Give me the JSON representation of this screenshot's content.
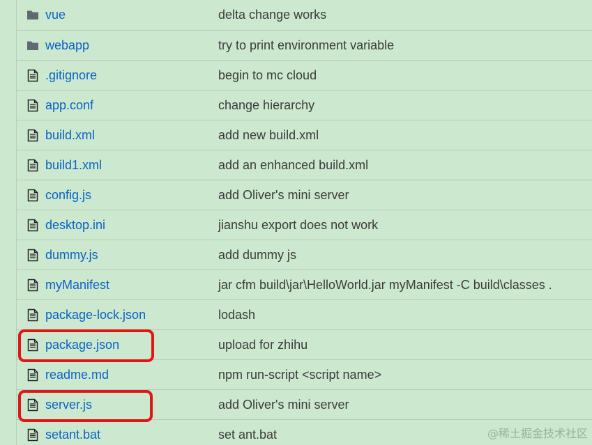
{
  "files": [
    {
      "icon": "folder-icon",
      "name": "vue",
      "message": "delta change works"
    },
    {
      "icon": "folder-icon",
      "name": "webapp",
      "message": "try to print environment variable"
    },
    {
      "icon": "file-icon",
      "name": ".gitignore",
      "message": "begin to mc cloud"
    },
    {
      "icon": "file-icon",
      "name": "app.conf",
      "message": "change hierarchy"
    },
    {
      "icon": "file-icon",
      "name": "build.xml",
      "message": "add new build.xml"
    },
    {
      "icon": "file-icon",
      "name": "build1.xml",
      "message": "add an enhanced build.xml"
    },
    {
      "icon": "file-icon",
      "name": "config.js",
      "message": "add Oliver's mini server"
    },
    {
      "icon": "file-icon",
      "name": "desktop.ini",
      "message": "jianshu export does not work"
    },
    {
      "icon": "file-icon",
      "name": "dummy.js",
      "message": "add dummy js"
    },
    {
      "icon": "file-icon",
      "name": "myManifest",
      "message": "jar cfm build\\jar\\HelloWorld.jar myManifest -C build\\classes ."
    },
    {
      "icon": "file-icon",
      "name": "package-lock.json",
      "message": "lodash"
    },
    {
      "icon": "file-icon",
      "name": "package.json",
      "message": "upload for zhihu"
    },
    {
      "icon": "file-icon",
      "name": "readme.md",
      "message": "npm run-script <script name>"
    },
    {
      "icon": "file-icon",
      "name": "server.js",
      "message": "add Oliver's mini server"
    },
    {
      "icon": "file-icon",
      "name": "setant.bat",
      "message": "set ant.bat"
    }
  ],
  "watermark": "@稀土掘金技术社区",
  "colors": {
    "background": "#cce8cf",
    "link": "#0b63c7",
    "text": "#3c3c3c",
    "highlight": "#e01515",
    "icon": "#5f6a70"
  }
}
